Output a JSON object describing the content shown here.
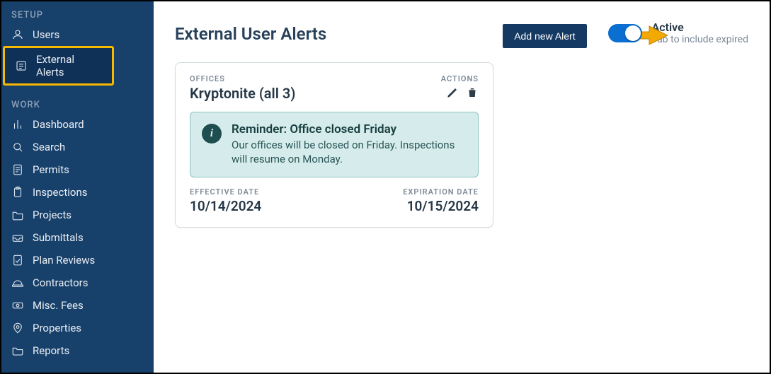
{
  "sidebar": {
    "sections": [
      {
        "heading": "SETUP",
        "items": [
          {
            "id": "users",
            "label": "Users",
            "active": false,
            "highlight": false
          },
          {
            "id": "external-alerts",
            "label": "External Alerts",
            "active": true,
            "highlight": true
          }
        ]
      },
      {
        "heading": "WORK",
        "items": [
          {
            "id": "dashboard",
            "label": "Dashboard"
          },
          {
            "id": "search",
            "label": "Search"
          },
          {
            "id": "permits",
            "label": "Permits"
          },
          {
            "id": "inspections",
            "label": "Inspections"
          },
          {
            "id": "projects",
            "label": "Projects"
          },
          {
            "id": "submittals",
            "label": "Submittals"
          },
          {
            "id": "plan-reviews",
            "label": "Plan Reviews"
          },
          {
            "id": "contractors",
            "label": "Contractors"
          },
          {
            "id": "misc-fees",
            "label": "Misc. Fees"
          },
          {
            "id": "properties",
            "label": "Properties"
          },
          {
            "id": "reports",
            "label": "Reports"
          }
        ]
      }
    ]
  },
  "top": {
    "title": "External User Alerts",
    "add_button": "Add new Alert",
    "toggle": {
      "on": true,
      "title": "Active",
      "subtitle": "Tab to include expired"
    }
  },
  "card": {
    "offices_label": "OFFICES",
    "offices_value": "Kryptonite (all 3)",
    "actions_label": "ACTIONS",
    "banner": {
      "title": "Reminder: Office closed Friday",
      "body": "Our offices will be closed on Friday. Inspections will resume on Monday."
    },
    "effective": {
      "label": "EFFECTIVE DATE",
      "value": "10/14/2024"
    },
    "expiration": {
      "label": "EXPIRATION DATE",
      "value": "10/15/2024"
    }
  },
  "icons": {
    "users": "person",
    "external-alerts": "list",
    "dashboard": "bar",
    "search": "search",
    "permits": "doc",
    "inspections": "clipboard",
    "projects": "folder",
    "submittals": "inbox",
    "plan-reviews": "doc-check",
    "contractors": "hardhat",
    "misc-fees": "money",
    "properties": "pin",
    "reports": "folder"
  },
  "colors": {
    "sidebar_bg": "#17406a",
    "primary_btn": "#143962",
    "switch_on": "#0a6fd0",
    "banner_bg": "#d6ecec",
    "banner_border": "#8cc2c3",
    "banner_fg": "#1e4e4f",
    "highlight": "#f6b800"
  }
}
